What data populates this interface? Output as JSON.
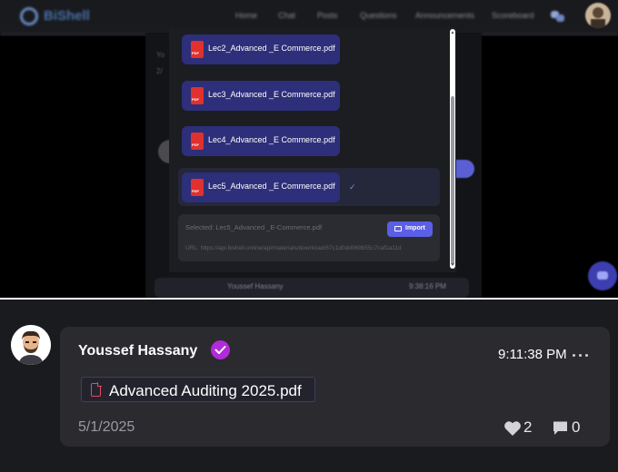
{
  "app": {
    "name": "BiShell",
    "nav_links": [
      "Home",
      "Chat",
      "Posts",
      "Questions",
      "Announcements",
      "Scoreboard"
    ]
  },
  "modal": {
    "files": [
      {
        "name": "Lec2_Advanced _E Commerce.pdf",
        "selected": false
      },
      {
        "name": "Lec3_Advanced _E Commerce.pdf",
        "selected": false
      },
      {
        "name": "Lec4_Advanced _E Commerce.pdf",
        "selected": false
      },
      {
        "name": "Lec5_Advanced _E Commerce.pdf",
        "selected": true
      }
    ],
    "selected_text": "Selected: Lec5_Advanced _E-Commerce.pdf",
    "url_text": "URL: https://api.bishell.online/api/materials/download/67c1d0dd069b55c7caf1a11d",
    "import_label": "Import",
    "check_icon": "check-icon"
  },
  "background": {
    "comment_author": "Youssef Hassany",
    "comment_time": "9:38:16 PM"
  },
  "comment": {
    "author": "Youssef Hassany",
    "verified": true,
    "time": "9:11:38 PM",
    "attachment": "Advanced Auditing 2025.pdf",
    "date": "5/1/2025",
    "likes": "2",
    "comments": "0"
  },
  "colors": {
    "accent": "#5b5fe6",
    "file_item_bg": "#2d2f7a",
    "verified_badge": "#b12bd9",
    "card_bg": "#2a2a2f"
  }
}
